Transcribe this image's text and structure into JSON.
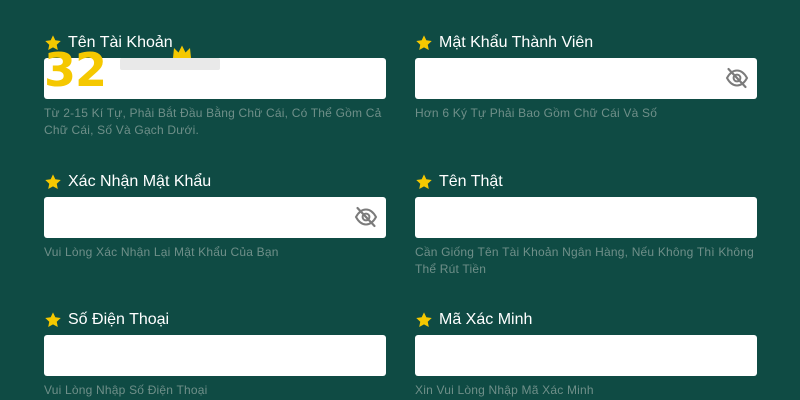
{
  "fields": {
    "username": {
      "label": "Tên Tài Khoản",
      "value": "",
      "placeholder": "",
      "hint": "Từ 2-15 Kí Tự, Phải Bắt Đầu Bằng Chữ Cái, Có Thể Gồm Cả Chữ Cái, Số Và Gạch Dưới."
    },
    "password": {
      "label": "Mật Khẩu Thành Viên",
      "value": "",
      "placeholder": "",
      "hint": "Hơn 6 Ký Tự Phải Bao Gồm Chữ Cái Và Số"
    },
    "confirm_password": {
      "label": "Xác Nhận Mật Khẩu",
      "value": "",
      "placeholder": "",
      "hint": "Vui Lòng Xác Nhận Lại Mật Khẩu Của Bạn"
    },
    "real_name": {
      "label": "Tên Thật",
      "value": "",
      "placeholder": "",
      "hint": "Cần Giống Tên Tài Khoản Ngân Hàng, Nếu Không Thì Không Thể Rút Tiền"
    },
    "phone": {
      "label": "Số Điện Thoại",
      "value": "",
      "placeholder": "",
      "hint": "Vui Lòng Nhập Số Điện Thoại"
    },
    "verification_code": {
      "label": "Mã Xác Minh",
      "value": "",
      "placeholder": "",
      "hint": "Xin Vui Lòng Nhập Mã Xác Minh"
    }
  },
  "logo": {
    "text": "32",
    "color": "#f5c800"
  },
  "icons": {
    "required": "star-icon",
    "password_toggle": "eye-slash-icon"
  },
  "colors": {
    "background": "#0f4b44",
    "star": "#f5c800",
    "hint_text": "#6f8f89",
    "input_bg": "#ffffff"
  }
}
